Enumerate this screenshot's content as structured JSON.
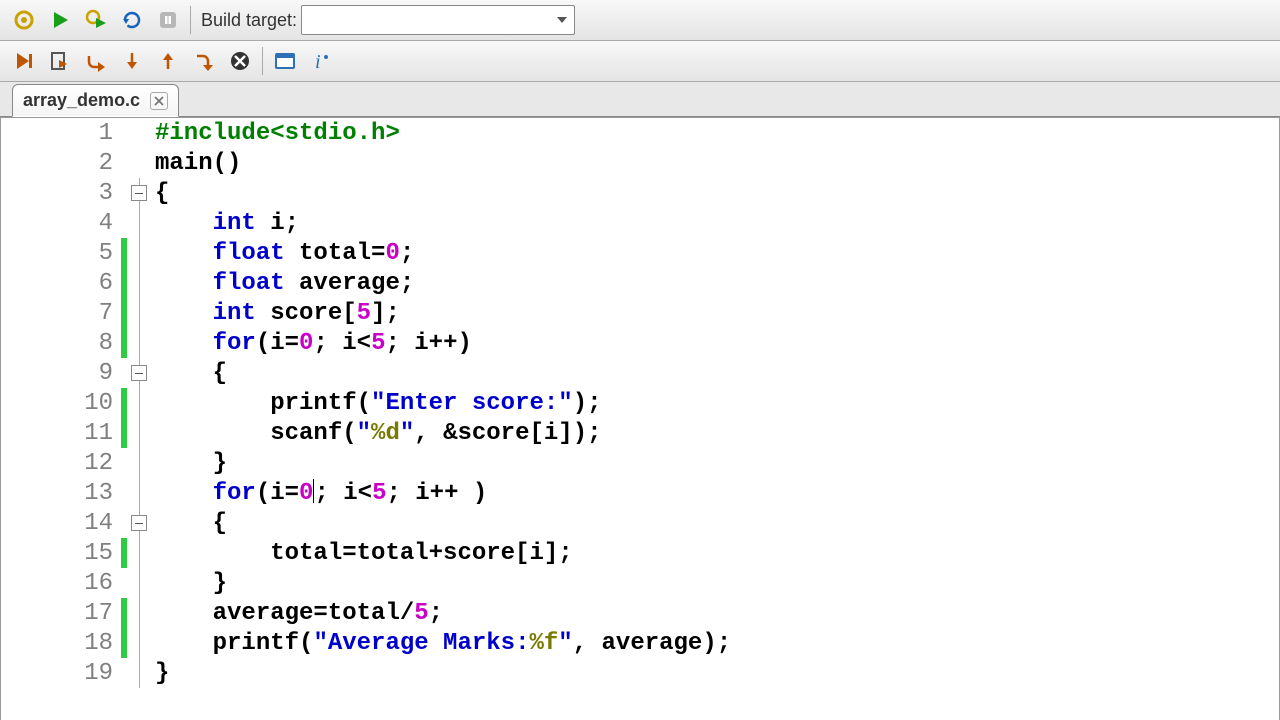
{
  "toolbar1": {
    "build_target_label": "Build target:",
    "build_target_value": ""
  },
  "tabs": [
    {
      "label": "array_demo.c"
    }
  ],
  "code": {
    "lines": [
      {
        "n": "1",
        "changed": false,
        "fold": null,
        "tokens": [
          [
            "pp",
            "#include<stdio.h>"
          ]
        ]
      },
      {
        "n": "2",
        "changed": false,
        "fold": null,
        "tokens": [
          [
            "",
            "main"
          ],
          [
            "",
            "()"
          ]
        ]
      },
      {
        "n": "3",
        "changed": false,
        "fold": "box",
        "tokens": [
          [
            "",
            "{"
          ]
        ]
      },
      {
        "n": "4",
        "changed": false,
        "fold": "line",
        "tokens": [
          [
            "",
            "    "
          ],
          [
            "kw",
            "int"
          ],
          [
            "",
            " i;"
          ]
        ]
      },
      {
        "n": "5",
        "changed": true,
        "fold": "line",
        "tokens": [
          [
            "",
            "    "
          ],
          [
            "kw",
            "float"
          ],
          [
            "",
            " total="
          ],
          [
            "num",
            "0"
          ],
          [
            "",
            ";"
          ]
        ]
      },
      {
        "n": "6",
        "changed": true,
        "fold": "line",
        "tokens": [
          [
            "",
            "    "
          ],
          [
            "kw",
            "float"
          ],
          [
            "",
            " average;"
          ]
        ]
      },
      {
        "n": "7",
        "changed": true,
        "fold": "line",
        "tokens": [
          [
            "",
            "    "
          ],
          [
            "kw",
            "int"
          ],
          [
            "",
            " score["
          ],
          [
            "num",
            "5"
          ],
          [
            "",
            "];"
          ]
        ]
      },
      {
        "n": "8",
        "changed": true,
        "fold": "line",
        "tokens": [
          [
            "",
            "    "
          ],
          [
            "kw",
            "for"
          ],
          [
            "",
            "(i="
          ],
          [
            "num",
            "0"
          ],
          [
            "",
            "; i<"
          ],
          [
            "num",
            "5"
          ],
          [
            "",
            "; i++)"
          ]
        ]
      },
      {
        "n": "9",
        "changed": false,
        "fold": "box",
        "tokens": [
          [
            "",
            "    {"
          ]
        ]
      },
      {
        "n": "10",
        "changed": true,
        "fold": "line",
        "tokens": [
          [
            "",
            "        printf("
          ],
          [
            "str",
            "\"Enter score:\""
          ],
          [
            "",
            ");"
          ]
        ]
      },
      {
        "n": "11",
        "changed": true,
        "fold": "line",
        "tokens": [
          [
            "",
            "        scanf("
          ],
          [
            "str",
            "\""
          ],
          [
            "fmt",
            "%d"
          ],
          [
            "str",
            "\""
          ],
          [
            "",
            ", &score[i]);"
          ]
        ]
      },
      {
        "n": "12",
        "changed": false,
        "fold": "line",
        "tokens": [
          [
            "",
            "    }"
          ]
        ]
      },
      {
        "n": "13",
        "changed": false,
        "fold": "line",
        "tokens": [
          [
            "",
            "    "
          ],
          [
            "kw",
            "for"
          ],
          [
            "",
            "(i="
          ],
          [
            "num",
            "0"
          ],
          [
            "cursor",
            ""
          ],
          [
            "",
            "; i<"
          ],
          [
            "num",
            "5"
          ],
          [
            "",
            "; i++ )"
          ]
        ]
      },
      {
        "n": "14",
        "changed": false,
        "fold": "box",
        "tokens": [
          [
            "",
            "    {"
          ]
        ]
      },
      {
        "n": "15",
        "changed": true,
        "fold": "line",
        "tokens": [
          [
            "",
            "        total=total+score[i];"
          ]
        ]
      },
      {
        "n": "16",
        "changed": false,
        "fold": "line",
        "tokens": [
          [
            "",
            "    }"
          ]
        ]
      },
      {
        "n": "17",
        "changed": true,
        "fold": "line",
        "tokens": [
          [
            "",
            "    average=total/"
          ],
          [
            "num",
            "5"
          ],
          [
            "",
            ";"
          ]
        ]
      },
      {
        "n": "18",
        "changed": true,
        "fold": "line",
        "tokens": [
          [
            "",
            "    printf("
          ],
          [
            "str",
            "\"Average Marks:"
          ],
          [
            "fmt",
            "%f"
          ],
          [
            "str",
            "\""
          ],
          [
            "",
            ", average);"
          ]
        ]
      },
      {
        "n": "19",
        "changed": false,
        "fold": "line",
        "tokens": [
          [
            "",
            "}"
          ]
        ]
      }
    ]
  }
}
